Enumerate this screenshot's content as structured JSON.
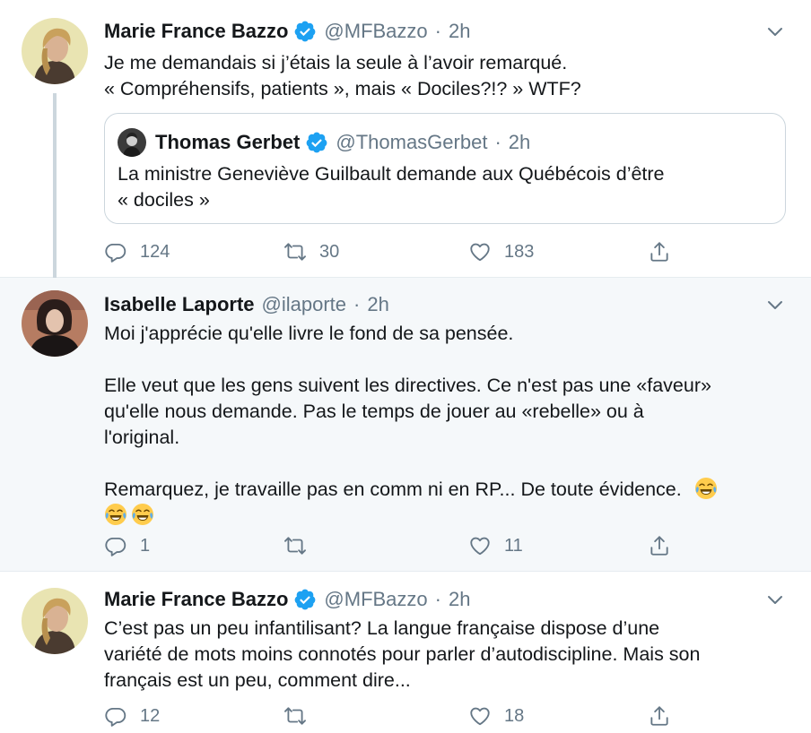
{
  "tweets": [
    {
      "author": "Marie France Bazzo",
      "handle": "@MFBazzo",
      "separator": "·",
      "time": "2h",
      "verified": true,
      "lines": [
        "Je me demandais si j’étais la seule à l’avoir remarqué.",
        "« Compréhensifs, patients », mais « Dociles?!? » WTF?"
      ],
      "quoted": {
        "author": "Thomas Gerbet",
        "handle": "@ThomasGerbet",
        "separator": "·",
        "time": "2h",
        "verified": true,
        "lines": [
          "La ministre Geneviève Guilbault demande aux Québécois d’être",
          "« dociles »"
        ]
      },
      "stats": {
        "replies": "124",
        "retweets": "30",
        "likes": "183"
      }
    },
    {
      "author": "Isabelle Laporte",
      "handle": "@ilaporte",
      "separator": "·",
      "time": "2h",
      "verified": false,
      "paragraph1": "Moi j'apprécie qu'elle livre le fond de sa pensée.",
      "paragraph2": [
        "Elle veut que les gens suivent les directives. Ce n'est pas une «faveur»",
        "qu'elle nous demande. Pas le temps de jouer au «rebelle» ou à",
        "l'original."
      ],
      "paragraph3": "Remarquez, je travaille pas en comm ni en RP... De toute évidence.",
      "emoji": "face-with-tears-of-joy",
      "stats": {
        "replies": "1",
        "retweets": "",
        "likes": "11"
      }
    },
    {
      "author": "Marie France Bazzo",
      "handle": "@MFBazzo",
      "separator": "·",
      "time": "2h",
      "verified": true,
      "lines": [
        "C’est pas un peu infantilisant? La langue française dispose d’une",
        "variété de mots moins connotés pour parler d’autodiscipline. Mais son",
        "français est un peu, comment dire..."
      ],
      "stats": {
        "replies": "12",
        "retweets": "",
        "likes": "18"
      }
    }
  ],
  "colors": {
    "accent": "#1da1f2",
    "secondary_text": "#657786",
    "highlight_background": "#f5f8fa",
    "thread_line": "#ccd6dd"
  },
  "icons": [
    "verified-icon",
    "chevron-down-icon",
    "reply-icon",
    "retweet-icon",
    "like-icon",
    "share-icon"
  ]
}
